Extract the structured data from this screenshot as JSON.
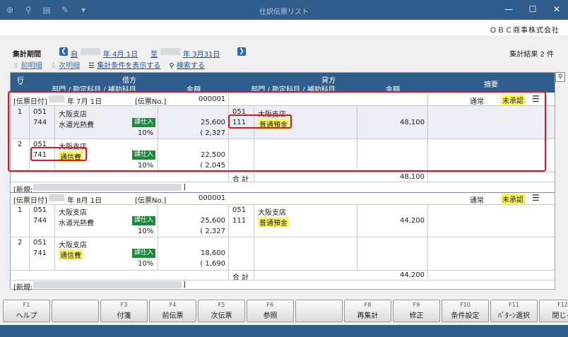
{
  "window": {
    "title": "仕訳伝票リスト"
  },
  "header": {
    "company": "ＯＢＣ商事株式会社"
  },
  "period": {
    "label": "集計期間",
    "from_prefix": "自",
    "from_suffix": "年 4月 1日",
    "to_prefix": "至",
    "to_suffix": "年 3月31日"
  },
  "result_count": "集計結果 2 件",
  "links": {
    "prev": "前明細",
    "next": "次明細",
    "show_conditions": "集計条件を表示する",
    "search": "検索する"
  },
  "columns": {
    "row": "行",
    "debit": "借方",
    "credit": "貸方",
    "account": "部門 / 勘定科目 / 補助科目",
    "amount": "金額",
    "summary": "摘要"
  },
  "vouchers": [
    {
      "date_label": "[伝票日付]",
      "date_suffix": "年 7月 1日",
      "no_label": "[伝票No.]",
      "no": "000001",
      "type": "通常",
      "status": "未承認",
      "lines": [
        {
          "row": "1",
          "debit_dept_code": "051",
          "debit_dept": "大阪支店",
          "debit_acct_code": "744",
          "debit_acct": "水道光熱費",
          "tax_tag": "課仕入",
          "debit_amount": "25,600",
          "tax_rate": "10%",
          "tax_amount": "( 2,327",
          "credit_dept_code": "051",
          "credit_dept": "大阪支店",
          "credit_acct_code": "111",
          "credit_acct": "普通預金",
          "credit_amount": "48,100"
        },
        {
          "row": "2",
          "debit_dept_code": "051",
          "debit_dept": "大阪支店",
          "debit_acct_code": "741",
          "debit_acct": "通信費",
          "tax_tag": "課仕入",
          "debit_amount": "22,500",
          "tax_rate": "10%",
          "tax_amount": "( 2,045"
        }
      ],
      "total_label": "合 計",
      "total": "48,100",
      "new_label": "[新規:"
    },
    {
      "date_label": "[伝票日付]",
      "date_suffix": "年 8月 1日",
      "no_label": "[伝票No.]",
      "no": "000001",
      "type": "通常",
      "status": "未承認",
      "lines": [
        {
          "row": "1",
          "debit_dept_code": "051",
          "debit_dept": "大阪支店",
          "debit_acct_code": "744",
          "debit_acct": "水道光熱費",
          "tax_tag": "課仕入",
          "debit_amount": "25,600",
          "tax_rate": "10%",
          "tax_amount": "( 2,327",
          "credit_dept_code": "051",
          "credit_dept": "大阪支店",
          "credit_acct_code": "111",
          "credit_acct": "普通預金",
          "credit_amount": "44,200"
        },
        {
          "row": "2",
          "debit_dept_code": "051",
          "debit_dept": "大阪支店",
          "debit_acct_code": "741",
          "debit_acct": "通信費",
          "tax_tag": "課仕入",
          "debit_amount": "18,600",
          "tax_rate": "10%",
          "tax_amount": "( 1,690"
        }
      ],
      "total_label": "合 計",
      "total": "44,200",
      "new_label": "[新規:"
    }
  ],
  "fkeys": [
    {
      "key": "F1",
      "label": "ヘルプ"
    },
    {
      "key": "",
      "label": ""
    },
    {
      "key": "F3",
      "label": "付箋"
    },
    {
      "key": "F4",
      "label": "前伝票"
    },
    {
      "key": "F5",
      "label": "次伝票"
    },
    {
      "key": "F6",
      "label": "参照"
    },
    {
      "key": "",
      "label": ""
    },
    {
      "key": "F8",
      "label": "再集計"
    },
    {
      "key": "F9",
      "label": "修正"
    },
    {
      "key": "F10",
      "label": "条件設定"
    },
    {
      "key": "F11",
      "label": "ﾊﾟﾀｰﾝ選択"
    },
    {
      "key": "F12",
      "label": "閉じる"
    }
  ]
}
